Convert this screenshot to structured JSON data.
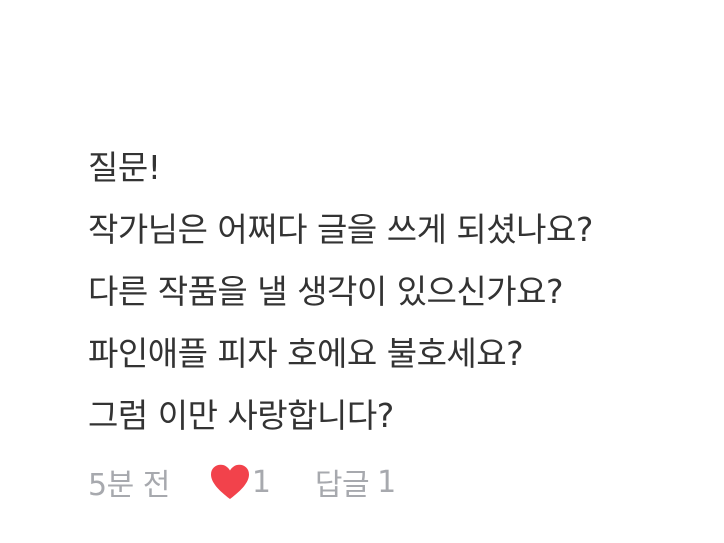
{
  "comment": {
    "lines": [
      "질문!",
      "작가님은 어쩌다 글을 쓰게 되셨나요?",
      "다른 작품을 낼 생각이 있으신가요?",
      "파인애플 피자 호에요 불호세요?",
      "그럼 이만 사랑합니다?"
    ]
  },
  "meta": {
    "time": "5분 전",
    "like_count": "1",
    "reply_label": "답글",
    "reply_count": "1",
    "heart_icon": "heart-icon",
    "heart_color": "#f2424b",
    "meta_color": "#a7a9ae",
    "text_color": "#333333"
  }
}
